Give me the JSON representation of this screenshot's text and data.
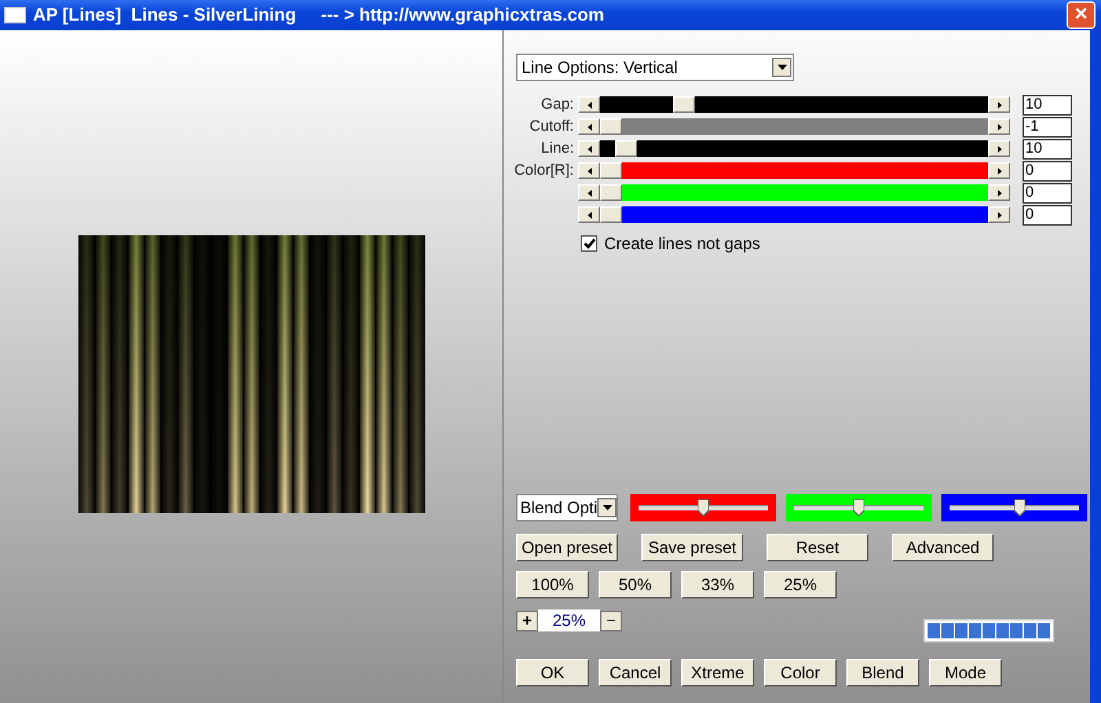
{
  "window": {
    "title": "AP [Lines]  Lines - SilverLining     --- > http://www.graphicxtras.com",
    "close": "×"
  },
  "options_dropdown": {
    "value": "Line Options: Vertical"
  },
  "sliders": [
    {
      "label": "Gap:",
      "color": "#000000",
      "level": 0.2,
      "value": "10"
    },
    {
      "label": "Cutoff:",
      "color": "#808080",
      "level": 0.0,
      "value": "-1"
    },
    {
      "label": "Line:",
      "color": "#000000",
      "level": 0.04,
      "value": "10"
    },
    {
      "label": "Color[R]:",
      "color": "#ff0000",
      "level": 0.0,
      "value": "0"
    },
    {
      "color": "#00ff00",
      "level": 0.0,
      "value": "0"
    },
    {
      "color": "#0000ff",
      "level": 0.0,
      "value": "0"
    }
  ],
  "checkbox": {
    "label": "Create lines not gaps",
    "checked": true
  },
  "blend_dropdown": {
    "value": "Blend Opti"
  },
  "blend_sliders": [
    {
      "color": "#ff0000",
      "level": 0.5
    },
    {
      "color": "#00ff00",
      "level": 0.5
    },
    {
      "color": "#0000ff",
      "level": 0.55
    }
  ],
  "preset_buttons": [
    "Open preset",
    "Save preset",
    "Reset",
    "Advanced"
  ],
  "zoom_buttons": [
    "100%",
    "50%",
    "33%",
    "25%"
  ],
  "zoom": {
    "plus": "+",
    "value": "25%",
    "minus": "−"
  },
  "bottom_buttons": [
    "OK",
    "Cancel",
    "Xtreme",
    "Color",
    "Blend",
    "Mode"
  ]
}
